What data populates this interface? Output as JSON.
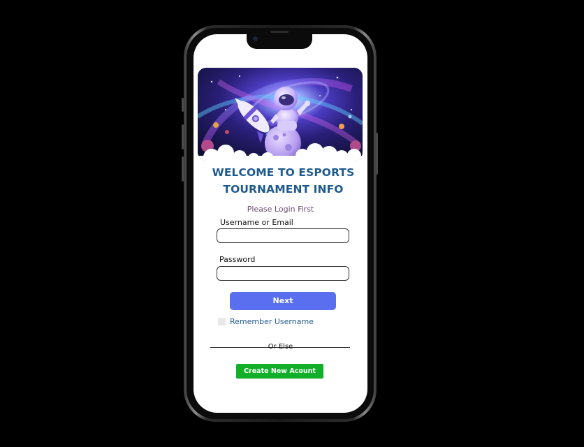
{
  "heading": {
    "line1": "WELCOME TO ESPORTS",
    "line2": "TOURNAMENT INFO"
  },
  "subtitle": "Please Login First",
  "form": {
    "username_label": "Username or Email",
    "username_value": "",
    "password_label": "Password",
    "password_value": "",
    "next_label": "Next",
    "remember_label": "Remember Username",
    "remember_checked": false
  },
  "divider_text": "Or Else",
  "create_account_label": "Create New Acount",
  "colors": {
    "title": "#1f5a8e",
    "next_button": "#5a6ef0",
    "create_button": "#12b02a",
    "background": "#000000"
  },
  "banner": {
    "icon": "astronaut-on-moon-with-rocket-illustration"
  }
}
